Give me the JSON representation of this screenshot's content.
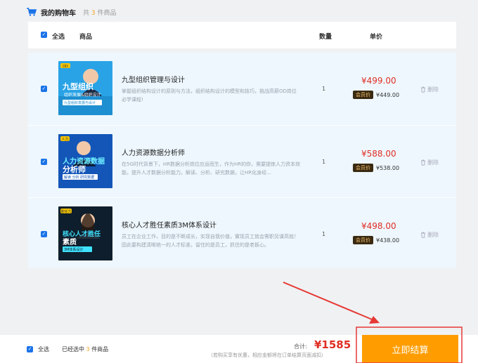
{
  "header": {
    "title": "我的购物车",
    "count_prefix": "共",
    "count": "3",
    "count_suffix": "件商品"
  },
  "table_head": {
    "select_all": "全选",
    "product": "商品",
    "quantity": "数量",
    "unit_price": "单价"
  },
  "items": [
    {
      "title": "九型组织管理与设计",
      "desc": "掌握组织结构设计的原则与方法，组织结构设计的模型和技巧，挑战高薪OD岗位必学课程!",
      "quantity": "1",
      "price": "¥499.00",
      "member_label": "会员价",
      "member_price": "¥449.00",
      "delete": "删除",
      "thumb": {
        "tag": "OD",
        "line1": "九型组织",
        "line2": "组织发展&组织设计",
        "line3": "九型组织发展与设计",
        "bg": "#29a3e6"
      }
    },
    {
      "title": "人力资源数据分析师",
      "desc": "在5G时代背景下，HR数据分析岗位应运而生，作为HR的你，需要提炼人力资本效能，提升人才数据分析能力。解读、分析、研究数据，让HR化身经...",
      "quantity": "1",
      "price": "¥588.00",
      "member_label": "会员价",
      "member_price": "¥538.00",
      "delete": "删除",
      "thumb": {
        "tag": "人力",
        "line1": "人力资源数据",
        "line2": "分析师",
        "line3": "解读 分析 研究数据",
        "bg": "#1456b8"
      }
    },
    {
      "title": "核心人才胜任素质3M体系设计",
      "desc": "员工在企业工作，目的是不断成长，实现自我价值，實现员工就会需职另谋高就！因此要构建清晰统一的人才标准，留住的是员工，抓住的是老板心。",
      "quantity": "1",
      "price": "¥498.00",
      "member_label": "会员价",
      "member_price": "¥438.00",
      "delete": "删除",
      "thumb": {
        "tag": "胜任力",
        "line1": "核心人才胜任",
        "line2": "素质",
        "line3": "3M体系设计",
        "bg": "#0e1e2c"
      }
    }
  ],
  "footer": {
    "select_all": "全选",
    "selected_prefix": "已经选中",
    "selected_count": "3",
    "selected_suffix": "件商品",
    "total_label": "合计:",
    "total": "¥1585",
    "note": "（若购买享有优惠，相应金额将在订单结算页面减扣）",
    "checkout": "立即结算"
  },
  "colors": {
    "accent": "#ff9d00",
    "price": "#e02e24",
    "checkbox": "#1a73e8",
    "annotation": "#e53935"
  },
  "icons": {
    "cart": "cart-icon",
    "check": "check-icon",
    "trash": "trash-icon",
    "arrow": "arrow-icon"
  }
}
